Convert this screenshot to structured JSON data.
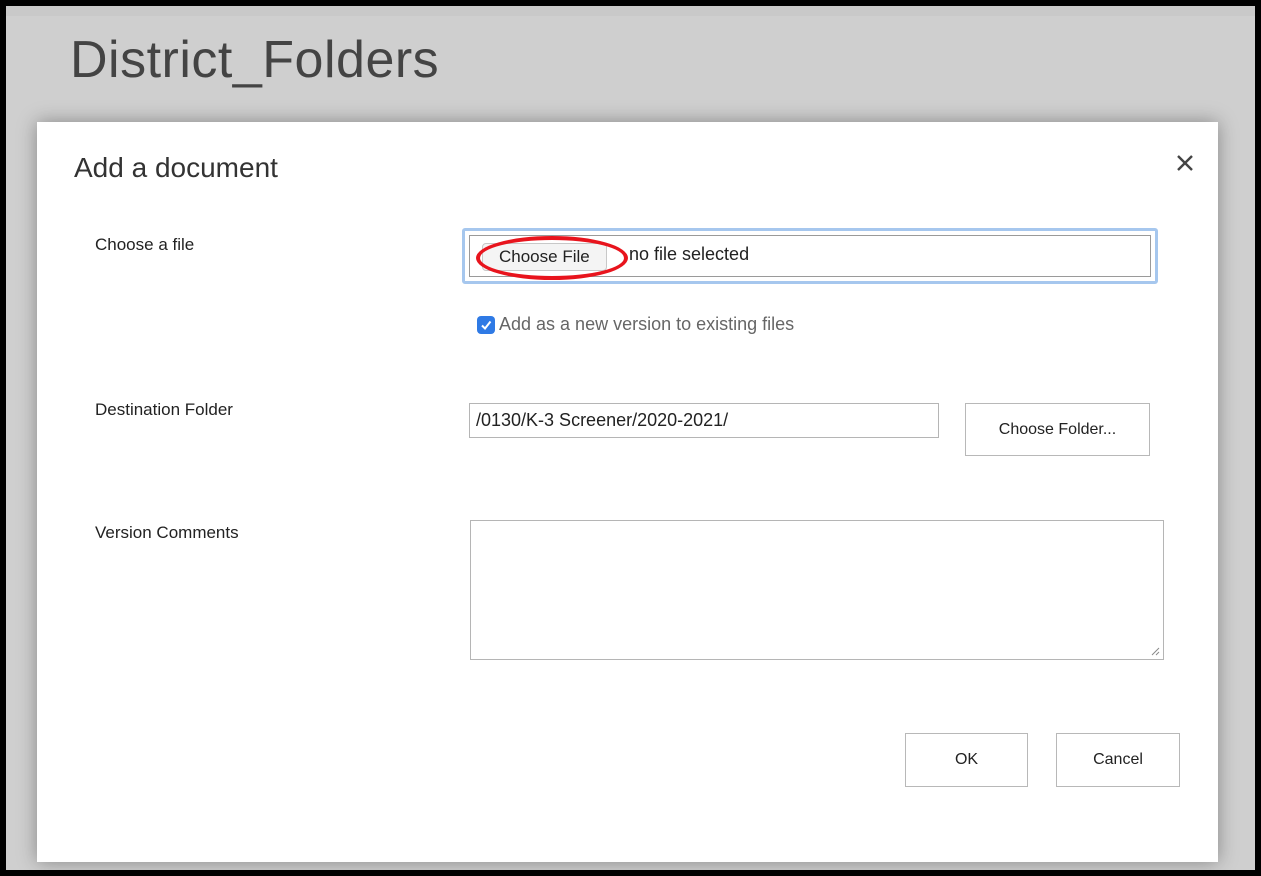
{
  "page": {
    "title": "District_Folders"
  },
  "dialog": {
    "title": "Add a document",
    "close_icon": "close-icon",
    "choose_file": {
      "label": "Choose a file",
      "button_label": "Choose File",
      "status_text": "no file selected"
    },
    "add_version": {
      "checked": true,
      "label": "Add as a new version to existing files"
    },
    "destination": {
      "label": "Destination Folder",
      "value": "/0130/K-3 Screener/2020-2021/",
      "button_label": "Choose Folder..."
    },
    "version_comments": {
      "label": "Version Comments",
      "value": ""
    },
    "ok_label": "OK",
    "cancel_label": "Cancel"
  },
  "colors": {
    "highlight": "#e8141d",
    "checkbox": "#2f7ae5",
    "focus_border": "#a6c7ee"
  }
}
